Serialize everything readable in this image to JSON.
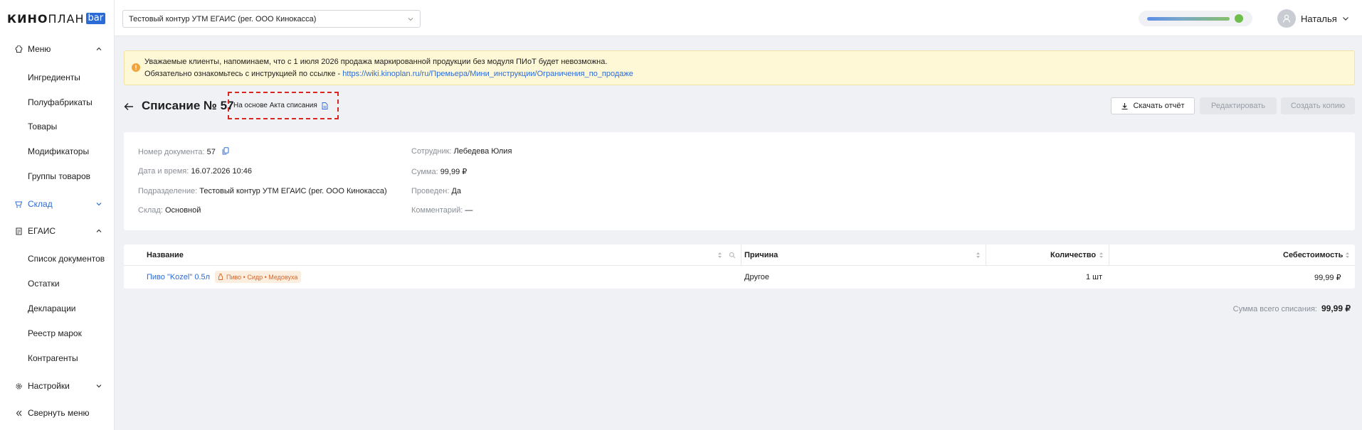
{
  "logo": {
    "part1": "КИНО",
    "part2": "ПЛАН",
    "badge": "bar"
  },
  "sidebar": {
    "menu": {
      "label": "Меню",
      "items": [
        "Ингредиенты",
        "Полуфабрикаты",
        "Товары",
        "Модификаторы",
        "Группы товаров"
      ]
    },
    "warehouse": {
      "label": "Склад"
    },
    "egais": {
      "label": "ЕГАИС",
      "items": [
        "Список документов",
        "Остатки",
        "Декларации",
        "Реестр марок",
        "Контрагенты"
      ]
    },
    "settings": {
      "label": "Настройки"
    },
    "collapse": {
      "label": "Свернуть меню"
    }
  },
  "topbar": {
    "contour": "Тестовый контур УТМ ЕГАИС (рег. ООО Кинокасса)",
    "user_name": "Наталья"
  },
  "alert": {
    "line1": "Уважаемые клиенты, напоминаем, что с 1 июля 2026 продажа маркированной продукции без модуля ПИоТ будет невозможна.",
    "line2_prefix": "Обязательно ознакомьтесь с инструкцией по ссылке - ",
    "link": "https://wiki.kinoplan.ru/ru/Премьера/Мини_инструкции/Ограничения_по_продаже"
  },
  "header": {
    "title": "Списание № 57",
    "basis": "На основе Акта списания",
    "download": "Скачать отчёт",
    "edit": "Редактировать",
    "copy": "Создать копию"
  },
  "info": {
    "doc_no_label": "Номер документа:",
    "doc_no": "57",
    "date_label": "Дата и время:",
    "date": "16.07.2026 10:46",
    "division_label": "Подразделение:",
    "division": "Тестовый контур УТМ ЕГАИС (рег. ООО Кинокасса)",
    "warehouse_label": "Склад:",
    "warehouse": "Основной",
    "employee_label": "Сотрудник:",
    "employee": "Лебедева Юлия",
    "sum_label": "Сумма:",
    "sum": "99,99 ₽",
    "posted_label": "Проведен:",
    "posted": "Да",
    "comment_label": "Комментарий:",
    "comment": "—"
  },
  "table": {
    "columns": [
      "Название",
      "Причина",
      "Количество",
      "Себестоимость"
    ],
    "rows": [
      {
        "name": "Пиво \"Kozel\" 0.5л",
        "tag": "Пиво • Сидр • Медовуха",
        "reason": "Другое",
        "qty": "1 шт",
        "cost": "99,99 ₽"
      }
    ]
  },
  "total": {
    "label": "Сумма всего списания:",
    "value": "99,99 ₽"
  }
}
